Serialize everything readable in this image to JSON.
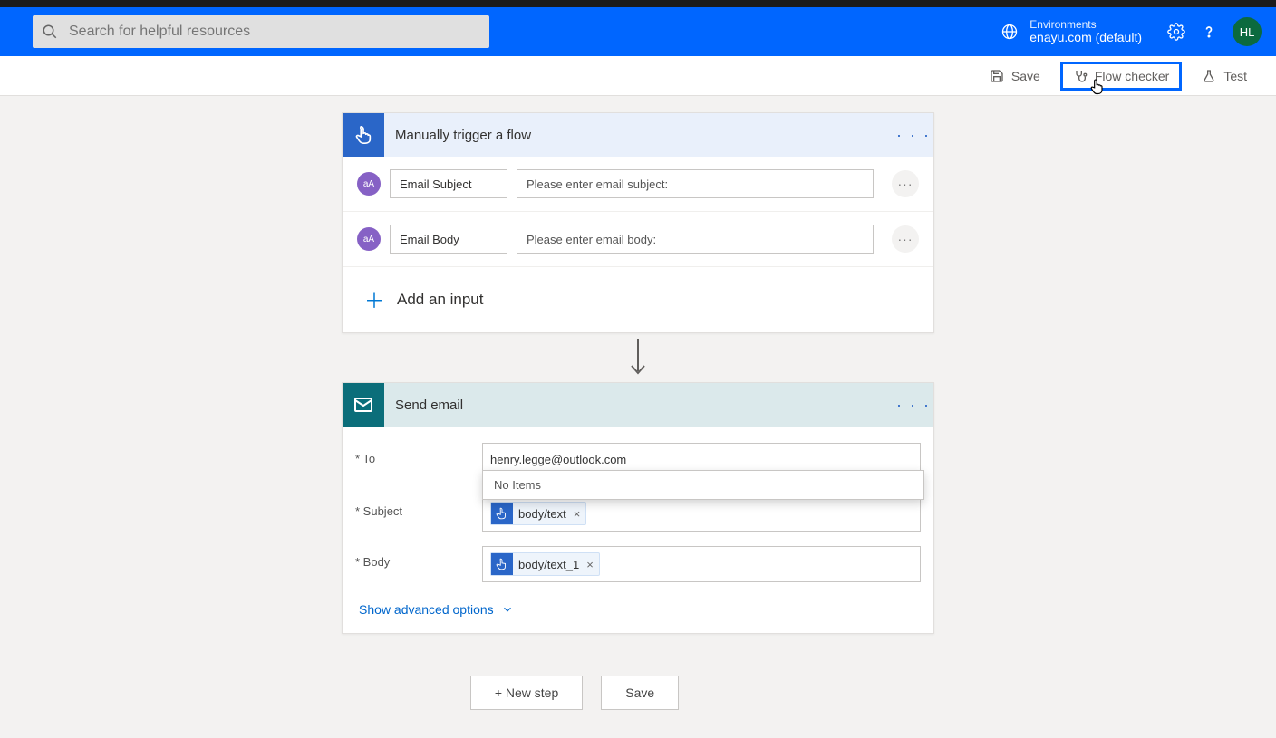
{
  "header": {
    "search_placeholder": "Search for helpful resources",
    "env_label": "Environments",
    "env_name": "enayu.com (default)",
    "avatar_initials": "HL"
  },
  "toolbar": {
    "save": "Save",
    "flow_checker": "Flow checker",
    "test": "Test"
  },
  "trigger": {
    "title": "Manually trigger a flow",
    "inputs": [
      {
        "name": "Email Subject",
        "placeholder": "Please enter email subject:"
      },
      {
        "name": "Email Body",
        "placeholder": "Please enter email body:"
      }
    ],
    "add_input": "Add an input"
  },
  "action": {
    "title": "Send email",
    "to_label": "* To",
    "to_value": "henry.legge@outlook.com",
    "dropdown_text": "No Items",
    "subject_label": "* Subject",
    "subject_token": "body/text",
    "body_label": "* Body",
    "body_token": "body/text_1",
    "advanced": "Show advanced options"
  },
  "footer": {
    "new_step": "+ New step",
    "save": "Save"
  }
}
